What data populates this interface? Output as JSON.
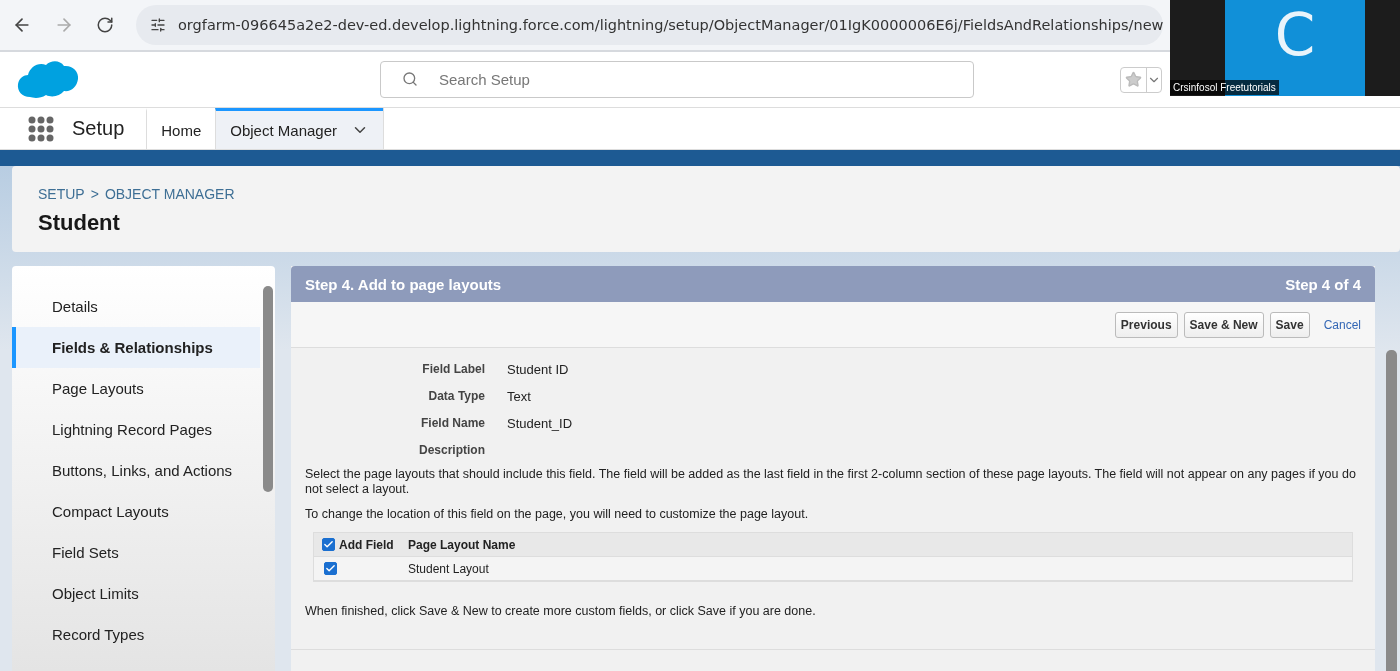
{
  "browser": {
    "url": "orgfarm-096645a2e2-dev-ed.develop.lightning.force.com/lightning/setup/ObjectManager/01IgK0000006E6j/FieldsAndRelationships/new"
  },
  "video_tile": {
    "initial": "C",
    "name": "Crsinfosol Freetutorials"
  },
  "header": {
    "search": {
      "placeholder": "Search Setup"
    }
  },
  "nav": {
    "app": "Setup",
    "tabs": [
      {
        "label": "Home",
        "selected": false,
        "menu": false
      },
      {
        "label": "Object Manager",
        "selected": true,
        "menu": true
      }
    ]
  },
  "page_header": {
    "breadcrumb": "SETUP",
    "separator": ">",
    "breadcrumb_2": "OBJECT MANAGER",
    "title": "Student"
  },
  "sidebar": {
    "items": [
      {
        "label": "Details",
        "selected": false
      },
      {
        "label": "Fields & Relationships",
        "selected": true
      },
      {
        "label": "Page Layouts",
        "selected": false
      },
      {
        "label": "Lightning Record Pages",
        "selected": false
      },
      {
        "label": "Buttons, Links, and Actions",
        "selected": false
      },
      {
        "label": "Compact Layouts",
        "selected": false
      },
      {
        "label": "Field Sets",
        "selected": false
      },
      {
        "label": "Object Limits",
        "selected": false
      },
      {
        "label": "Record Types",
        "selected": false
      }
    ]
  },
  "step": {
    "title": "Step 4. Add to page layouts",
    "counter": "Step 4 of 4",
    "buttons": [
      "Previous",
      "Save & New",
      "Save"
    ],
    "cancel": "Cancel",
    "fields": [
      {
        "label": "Field Label",
        "value": "Student ID"
      },
      {
        "label": "Data Type",
        "value": "Text"
      },
      {
        "label": "Field Name",
        "value": "Student_ID"
      },
      {
        "label": "Description"
      }
    ],
    "intro": "Select the page layouts that should include this field. The field will be added as the last field in the first 2-column section of these page layouts. The field will not appear on any pages if you do not select a layout.",
    "note": "To change the location of this field on the page, you will need to customize the page layout.",
    "table": {
      "columns": [
        {
          "label": "Add Field",
          "checked": true
        },
        {
          "label": "Page Layout Name"
        }
      ],
      "rows": [
        {
          "checked": true,
          "name": "Student Layout"
        }
      ]
    },
    "footer_text": "When finished, click Save & New to create more custom fields, or click Save if you are done."
  }
}
